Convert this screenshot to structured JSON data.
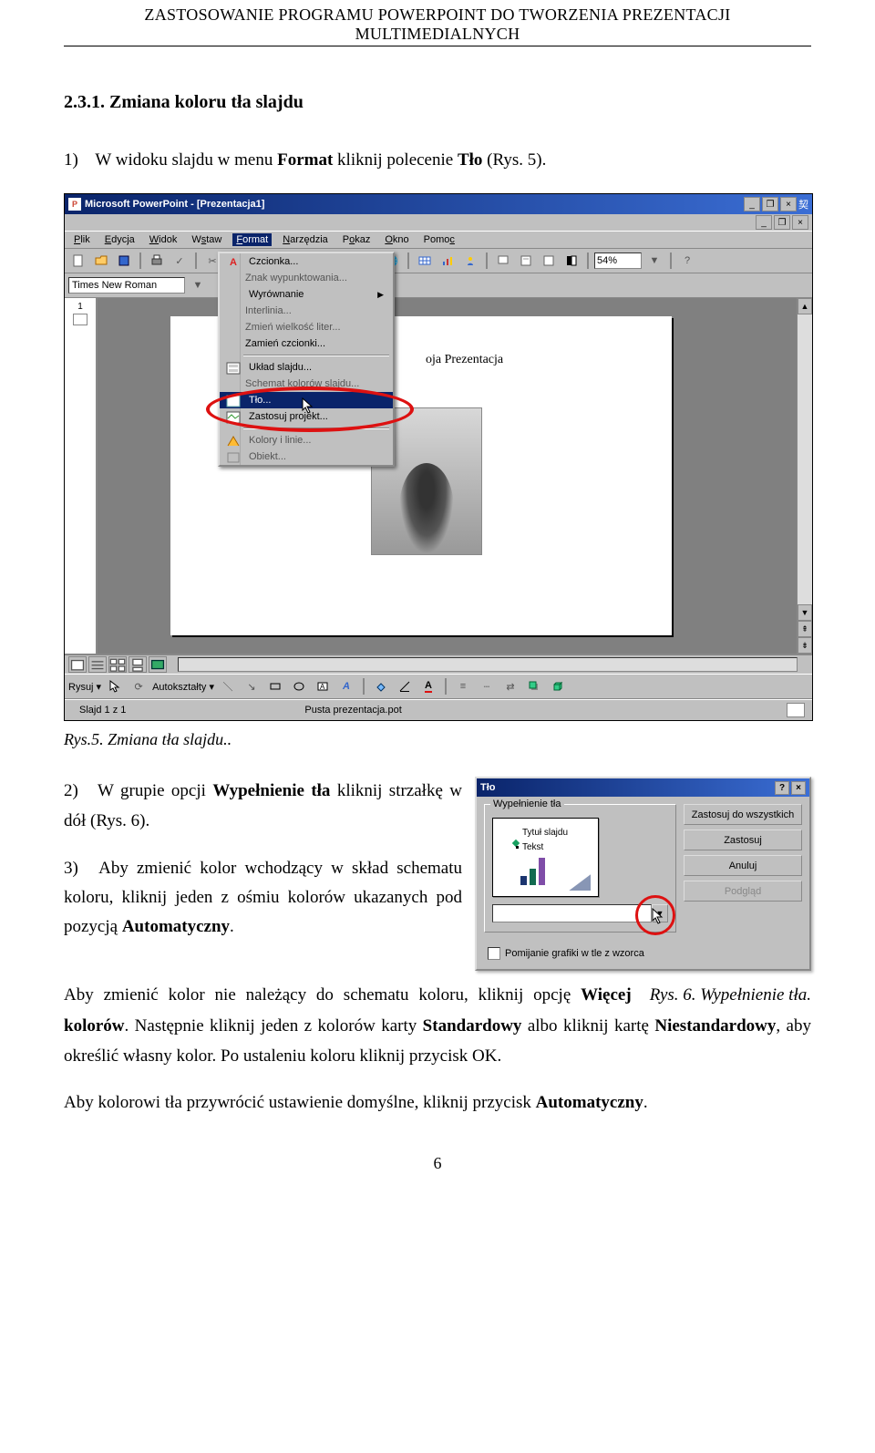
{
  "header": "ZASTOSOWANIE PROGRAMU POWERPOINT DO TWORZENIA PREZENTACJI MULTIMEDIALNYCH",
  "section_number": "2.3.1.",
  "section_title": "Zmiana koloru tła slajdu",
  "step1": {
    "marker": "1)",
    "pre": "W widoku slajdu w menu ",
    "bold1": "Format",
    "mid": " kliknij polecenie ",
    "bold2": "Tło",
    "post": " (Rys. 5)."
  },
  "fig1_caption": "Rys.5. Zmiana tła slajdu..",
  "ppwin": {
    "icon_text": "P",
    "title": "Microsoft PowerPoint - [Prezentacja1]",
    "winbtn_min": "_",
    "winbtn_max": "❐",
    "winbtn_close": "×",
    "menubar": {
      "plik": "Plik",
      "edycja": "Edycja",
      "widok": "Widok",
      "wstaw": "Wstaw",
      "format": "Format",
      "narzedzia": "Narzędzia",
      "pokaz": "Pokaz",
      "okno": "Okno",
      "pomoc": "Pomoc"
    },
    "zoom": "54%",
    "font": "Times New Roman",
    "outline_num": "1",
    "slide_text": "oja Prezentacja",
    "draw_label": "Rysuj ▾",
    "autoshapes_label": "Autokształty ▾",
    "status_left": "Slajd 1 z 1",
    "status_center": "Pusta prezentacja.pot",
    "sbtn_up": "▲",
    "sbtn_down": "▼",
    "sbtn_prev": "⇞",
    "sbtn_next": "⇟"
  },
  "format_menu": {
    "czcionka": "Czcionka...",
    "znak": "Znak wypunktowania...",
    "wyrownanie": "Wyrównanie",
    "interlinia": "Interlinia...",
    "zmien_wlk": "Zmień wielkość liter...",
    "zamien": "Zamień czcionki...",
    "uklad": "Układ slajdu...",
    "schemat": "Schemat kolorów slajdu...",
    "tlo": "Tło...",
    "zastosuj": "Zastosuj projekt...",
    "kolory": "Kolory i linie...",
    "obiekt": "Obiekt...",
    "arrow": "▶"
  },
  "step2": {
    "marker": "2)",
    "pre": "W grupie opcji ",
    "bold": "Wypełnienie tła",
    "post": " kliknij strzałkę w dół (Rys. 6)."
  },
  "step3": {
    "marker": "3)",
    "pre": "Aby zmienić kolor wchodzący w skład schematu koloru, kliknij jeden z ośmiu kolorów ukazanych pod pozycją ",
    "bold": "Automatyczny",
    "post": "."
  },
  "dlg": {
    "title": "Tło",
    "q": "?",
    "x": "×",
    "group_label": "Wypełnienie tła",
    "pv_title": "Tytuł slajdu",
    "pv_text": "Tekst",
    "combo_arrow": "▼",
    "check_label": "Pomijanie grafiki w tle z wzorca",
    "btn_apply_all": "Zastosuj do wszystkich",
    "btn_apply": "Zastosuj",
    "btn_cancel": "Anuluj",
    "btn_preview": "Podgląd"
  },
  "fig2_caption": "Rys. 6. Wypełnienie tła.",
  "para_after": {
    "pre": "Aby zmienić kolor nie należący do schematu koloru, kliknij opcję ",
    "bold1": "Więcej kolorów",
    "mid1": ". Następnie kliknij jeden z kolorów karty ",
    "bold2": "Standardowy",
    "mid2": " albo kliknij kartę ",
    "bold3": "Niestandardowy",
    "post": ", aby określić własny kolor. Po ustaleniu koloru kliknij przycisk OK."
  },
  "para_last": {
    "pre": "Aby kolorowi tła przywrócić ustawienie domyślne, kliknij przycisk ",
    "bold": "Automatyczny",
    "post": "."
  },
  "page_num": "6"
}
